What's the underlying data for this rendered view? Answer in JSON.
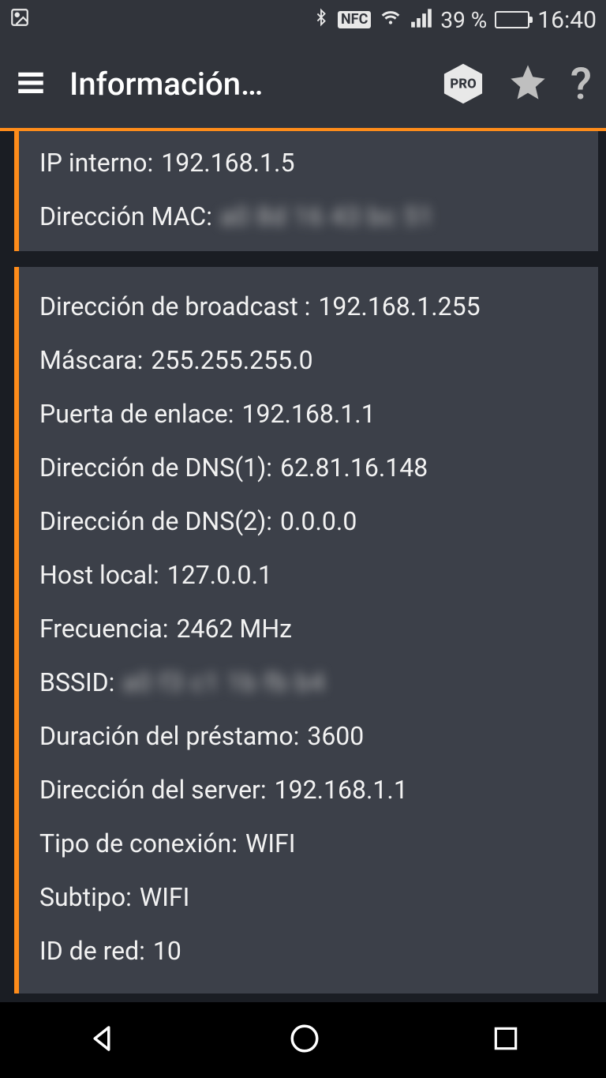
{
  "status": {
    "battery_pct_text": "39 %",
    "battery_fill_pct": 39,
    "time": "16:40",
    "nfc": "NFC"
  },
  "appbar": {
    "title": "Información…"
  },
  "card1": {
    "ip_label": "IP interno:",
    "ip_value": "192.168.1.5",
    "mac_label": "Dirección MAC:",
    "mac_value": "a0 8d 16 43 bc 51"
  },
  "card2": {
    "broadcast_label": "Dirección de broadcast :",
    "broadcast_value": "192.168.1.255",
    "mask_label": "Máscara:",
    "mask_value": "255.255.255.0",
    "gateway_label": "Puerta de enlace:",
    "gateway_value": "192.168.1.1",
    "dns1_label": "Dirección de DNS(1):",
    "dns1_value": "62.81.16.148",
    "dns2_label": "Dirección de DNS(2):",
    "dns2_value": "0.0.0.0",
    "localhost_label": "Host local:",
    "localhost_value": "127.0.0.1",
    "freq_label": "Frecuencia:",
    "freq_value": "2462 MHz",
    "bssid_label": "BSSID:",
    "bssid_value": "a0 f3 c1 1b fb b4",
    "lease_label": "Duración del préstamo:",
    "lease_value": "3600",
    "server_label": "Dirección del server:",
    "server_value": "192.168.1.1",
    "conn_label": "Tipo de conexión:",
    "conn_value": "WIFI",
    "subtype_label": "Subtipo:",
    "subtype_value": "WIFI",
    "netid_label": "ID de red:",
    "netid_value": "10"
  }
}
